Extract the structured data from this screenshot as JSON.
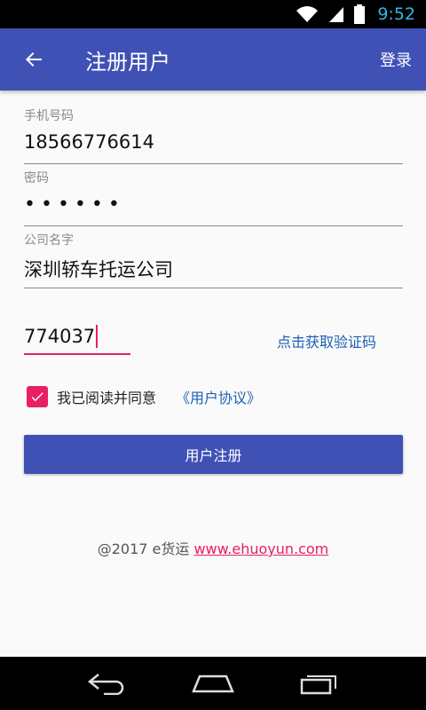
{
  "status_bar": {
    "time": "9:52"
  },
  "app_bar": {
    "title": "注册用户",
    "login_label": "登录"
  },
  "form": {
    "phone": {
      "label": "手机号码",
      "value": "18566776614"
    },
    "password": {
      "label": "密码",
      "value": "••••••"
    },
    "company": {
      "label": "公司名字",
      "value": "深圳轿车托运公司"
    },
    "code": {
      "value": "774037"
    },
    "get_code_label": "点击获取验证码",
    "agree_text": "我已阅读并同意",
    "agreement_link": "《用户协议》",
    "agree_checked": true,
    "register_label": "用户注册"
  },
  "footer": {
    "copyright": "@2017 e货运",
    "site": "www.ehuoyun.com"
  },
  "colors": {
    "primary": "#3f51b5",
    "accent": "#e91e63",
    "link": "#1c5fb4"
  },
  "icons": [
    "wifi-icon",
    "signal-icon",
    "battery-icon",
    "back-arrow-icon",
    "check-icon",
    "nav-back-icon",
    "nav-home-icon",
    "nav-recents-icon"
  ]
}
